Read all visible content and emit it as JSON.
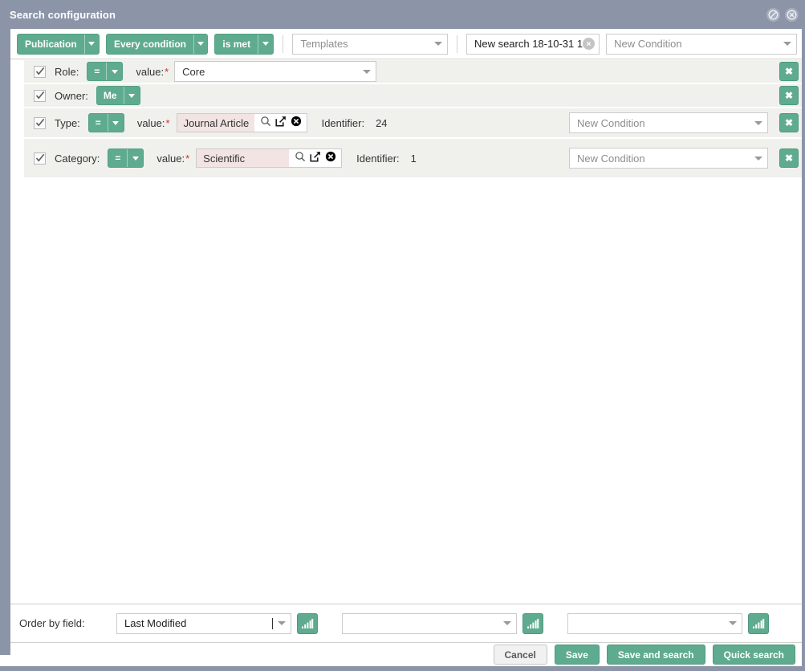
{
  "window": {
    "title": "Search configuration",
    "icons": [
      {
        "name": "block-icon",
        "glyph": "circle-slash"
      },
      {
        "name": "close-icon",
        "glyph": "circle-x"
      }
    ]
  },
  "toolbar": {
    "entity_button": {
      "label": "Publication",
      "icon": "chevron-down-icon"
    },
    "condition_button": {
      "label": "Every condition",
      "icon": "chevron-down-icon"
    },
    "met_button": {
      "label": "is met",
      "icon": "chevron-down-icon"
    },
    "templates_select": {
      "value": "Templates",
      "is_placeholder": true
    },
    "search_name": {
      "value": "New search 18-10-31 1",
      "clear_icon": "clear-circle-icon"
    },
    "new_condition_select": {
      "value": "New Condition",
      "is_placeholder": true
    }
  },
  "conditions": [
    {
      "checked": true,
      "field_label": "Role:",
      "operator": "=",
      "value_label": "value:",
      "required": "*",
      "editor": "select",
      "value": "Core",
      "has_identifier": false,
      "identifier_label": "",
      "identifier_value": "",
      "new_condition": null,
      "delete_label": "✖"
    },
    {
      "checked": true,
      "field_label": "Owner:",
      "operator": "Me",
      "value_label": "",
      "required": "",
      "editor": "none",
      "value": "",
      "has_identifier": false,
      "identifier_label": "",
      "identifier_value": "",
      "new_condition": null,
      "delete_label": "✖"
    },
    {
      "checked": true,
      "field_label": "Type:",
      "operator": "=",
      "value_label": "value:",
      "required": "*",
      "editor": "lookup",
      "value": "Journal Article",
      "has_identifier": true,
      "identifier_label": "Identifier:",
      "identifier_value": "24",
      "new_condition": "New Condition",
      "delete_label": "✖"
    },
    {
      "checked": true,
      "field_label": "Category:",
      "operator": "=",
      "value_label": "value:",
      "required": "*",
      "editor": "lookup",
      "value": "Scientific",
      "has_identifier": true,
      "identifier_label": "Identifier:",
      "identifier_value": "1",
      "new_condition": "New Condition",
      "delete_label": "✖"
    }
  ],
  "lookup_icons": [
    {
      "name": "search-icon"
    },
    {
      "name": "open-external-icon"
    },
    {
      "name": "clear-value-icon"
    }
  ],
  "footer": {
    "order_label": "Order by field:",
    "order_selects": [
      {
        "value": "Last Modified",
        "is_placeholder": false,
        "has_cursor": true,
        "spellcheck_underline": true
      },
      {
        "value": "",
        "is_placeholder": true,
        "has_cursor": false,
        "spellcheck_underline": false
      },
      {
        "value": "",
        "is_placeholder": true,
        "has_cursor": false,
        "spellcheck_underline": false
      }
    ],
    "sort_icon_name": "sort-ascending-bars-icon",
    "buttons": [
      {
        "label": "Cancel",
        "style": "gray",
        "name": "cancel-button"
      },
      {
        "label": "Save",
        "style": "green",
        "name": "save-button"
      },
      {
        "label": "Save and search",
        "style": "green",
        "name": "save-and-search-button"
      },
      {
        "label": "Quick search",
        "style": "green",
        "name": "quick-search-button"
      }
    ]
  },
  "colors": {
    "accent_green": "#5fab8f",
    "chrome_slate": "#8c95a8",
    "row_bg": "#f0f0ed",
    "lookup_value_bg": "#f2e4e2",
    "required_red": "#c0392b"
  }
}
